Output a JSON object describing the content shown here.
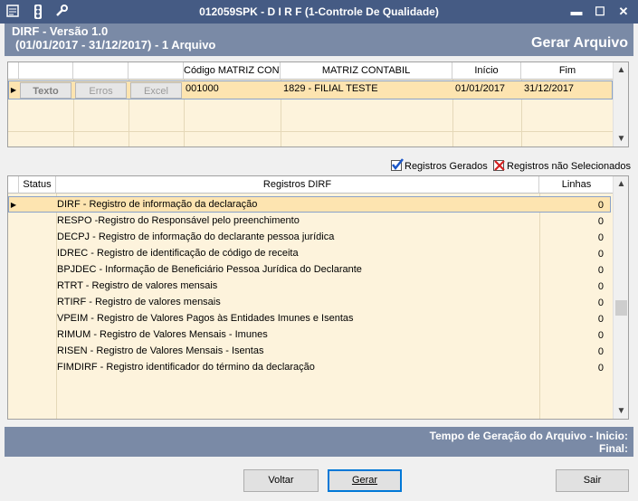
{
  "window": {
    "title": "012059SPK - D I R F (1-Controle De Qualidade)",
    "icons": [
      "app-menu-icon",
      "traffic-light-icon",
      "wrench-icon"
    ],
    "controls": {
      "minimize": "▬",
      "maximize": "☐",
      "close": "✕"
    }
  },
  "header": {
    "title": "DIRF - Versão 1.0",
    "subtitle": "(01/01/2017 - 31/12/2017) - 1 Arquivo",
    "action_title": "Gerar Arquivo"
  },
  "files_grid": {
    "columns": [
      "",
      "",
      "",
      "Código MATRIZ CONTABIL",
      "MATRIZ CONTABIL",
      "Início",
      "Fim"
    ],
    "row": {
      "buttons": [
        "Texto",
        "Erros",
        "Excel"
      ],
      "codigo": "001000",
      "matriz": "1829 - FILIAL TESTE",
      "inicio": "01/01/2017",
      "fim": "31/12/2017"
    }
  },
  "legend": {
    "generated": "Registros Gerados",
    "not_selected": "Registros não Selecionados"
  },
  "records_grid": {
    "columns": [
      "Status",
      "Registros DIRF",
      "Linhas"
    ],
    "rows": [
      {
        "name": "DIRF - Registro de informação da declaração",
        "lines": "0"
      },
      {
        "name": "RESPO -Registro do Responsável pelo preenchimento",
        "lines": "0"
      },
      {
        "name": "DECPJ - Registro de informação do declarante pessoa jurídica",
        "lines": "0"
      },
      {
        "name": "IDREC - Registro de identificação de código de receita",
        "lines": "0"
      },
      {
        "name": "BPJDEC - Informação de Beneficiário Pessoa Jurídica do Declarante",
        "lines": "0"
      },
      {
        "name": "RTRT - Registro de valores mensais",
        "lines": "0"
      },
      {
        "name": "RTIRF - Registro de valores mensais",
        "lines": "0"
      },
      {
        "name": "VPEIM - Registro de Valores Pagos às Entidades Imunes e Isentas",
        "lines": "0"
      },
      {
        "name": "RIMUM - Registro de Valores Mensais - Imunes",
        "lines": "0"
      },
      {
        "name": "RISEN - Registro de Valores Mensais - Isentas",
        "lines": "0"
      },
      {
        "name": "FIMDIRF - Registro identificador do término da declaração",
        "lines": "0"
      }
    ]
  },
  "status": {
    "line1": "Tempo de Geração do Arquivo - Inicio:",
    "line2": "Final:"
  },
  "buttons": {
    "voltar": "Voltar",
    "gerar": "Gerar",
    "sair": "Sair"
  },
  "colors": {
    "titlebar": "#455b84",
    "header_band": "#7a8aa6",
    "row_fill": "#fdf3dc",
    "selected_row": "#fde4b0",
    "check_blue": "#1a56c8",
    "check_red": "#d42020"
  }
}
